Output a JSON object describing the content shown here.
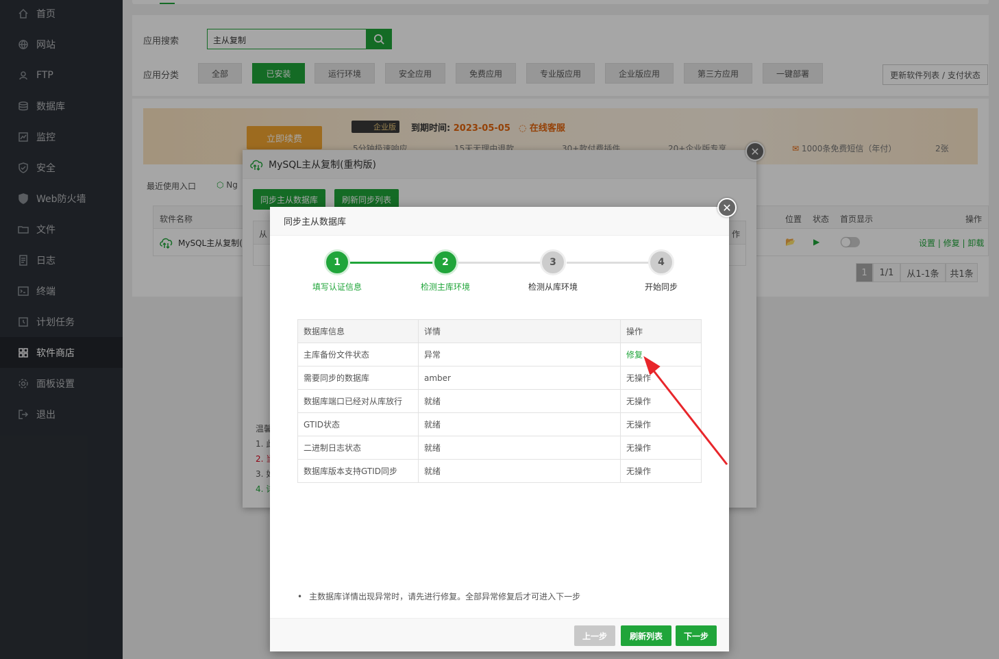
{
  "sidebar": {
    "items": [
      {
        "label": "首页",
        "icon": "home-icon"
      },
      {
        "label": "网站",
        "icon": "globe-icon"
      },
      {
        "label": "FTP",
        "icon": "ftp-icon"
      },
      {
        "label": "数据库",
        "icon": "database-icon"
      },
      {
        "label": "监控",
        "icon": "monitor-icon"
      },
      {
        "label": "安全",
        "icon": "shield-icon"
      },
      {
        "label": "Web防火墙",
        "icon": "firewall-icon"
      },
      {
        "label": "文件",
        "icon": "folder-icon"
      },
      {
        "label": "日志",
        "icon": "log-icon"
      },
      {
        "label": "终端",
        "icon": "terminal-icon"
      },
      {
        "label": "计划任务",
        "icon": "clock-icon"
      },
      {
        "label": "软件商店",
        "icon": "grid-icon"
      },
      {
        "label": "面板设置",
        "icon": "gear-icon"
      },
      {
        "label": "退出",
        "icon": "logout-icon"
      }
    ],
    "active_index": 11
  },
  "store": {
    "search_label": "应用搜索",
    "search_value": "主从复制",
    "category_label": "应用分类",
    "categories": [
      "全部",
      "已安装",
      "运行环境",
      "安全应用",
      "免费应用",
      "专业版应用",
      "企业版应用",
      "第三方应用",
      "一键部署"
    ],
    "active_category": "已安装",
    "refresh_button": "更新软件列表 / 支付状态"
  },
  "banner": {
    "renew_button": "立即续费",
    "edition": "企业版",
    "expire_label": "到期时间:",
    "expire_date": "2023-05-05",
    "online_service": "在线客服",
    "perks": [
      "5分钟极速响应",
      "15天无理由退款",
      "30+款付费插件",
      "20+企业版专享",
      "1000条免费短信（年付）",
      "2张"
    ]
  },
  "recent": {
    "label": "最近使用入口",
    "item": "Ng"
  },
  "software_table": {
    "headers": [
      "软件名称",
      "位置",
      "状态",
      "首页显示",
      "操作"
    ],
    "row": {
      "name": "MySQL主从复制(重",
      "actions": [
        "设置",
        "修复",
        "卸载"
      ]
    },
    "pager": {
      "current": "1",
      "pages": "1/1",
      "range": "从1-1条",
      "total": "共1条"
    }
  },
  "modal1": {
    "title": "MySQL主从复制(重构版)",
    "buttons": [
      "同步主从数据库",
      "刷新同步列表"
    ],
    "col_left": "从",
    "col_right": "作",
    "hints": [
      "温馨",
      "1. 此",
      "2. 当",
      "3. 如",
      "4. 详"
    ]
  },
  "modal2": {
    "title": "同步主从数据库",
    "steps": [
      {
        "num": "1",
        "label": "填写认证信息",
        "done": true
      },
      {
        "num": "2",
        "label": "检测主库环境",
        "done": true
      },
      {
        "num": "3",
        "label": "检测从库环境",
        "done": false
      },
      {
        "num": "4",
        "label": "开始同步",
        "done": false
      }
    ],
    "table_headers": [
      "数据库信息",
      "详情",
      "操作"
    ],
    "rows": [
      {
        "info": "主库备份文件状态",
        "detail": "异常",
        "detail_status": "error",
        "action": "修复",
        "action_link": true
      },
      {
        "info": "需要同步的数据库",
        "detail": "amber",
        "detail_status": "plain",
        "action": "无操作",
        "action_link": false
      },
      {
        "info": "数据库端口已经对从库放行",
        "detail": "就绪",
        "detail_status": "ok",
        "action": "无操作",
        "action_link": false
      },
      {
        "info": "GTID状态",
        "detail": "就绪",
        "detail_status": "ok",
        "action": "无操作",
        "action_link": false
      },
      {
        "info": "二进制日志状态",
        "detail": "就绪",
        "detail_status": "ok",
        "action": "无操作",
        "action_link": false
      },
      {
        "info": "数据库版本支持GTID同步",
        "detail": "就绪",
        "detail_status": "ok",
        "action": "无操作",
        "action_link": false
      }
    ],
    "note": "主数据库详情出现异常时，请先进行修复。全部异常修复后才可进入下一步",
    "footer": {
      "prev": "上一步",
      "refresh": "刷新列表",
      "next": "下一步"
    }
  },
  "colors": {
    "accent": "#20a53a",
    "error": "#d9001b",
    "sidebar": "#2c3138",
    "arrow": "#e8262b"
  }
}
